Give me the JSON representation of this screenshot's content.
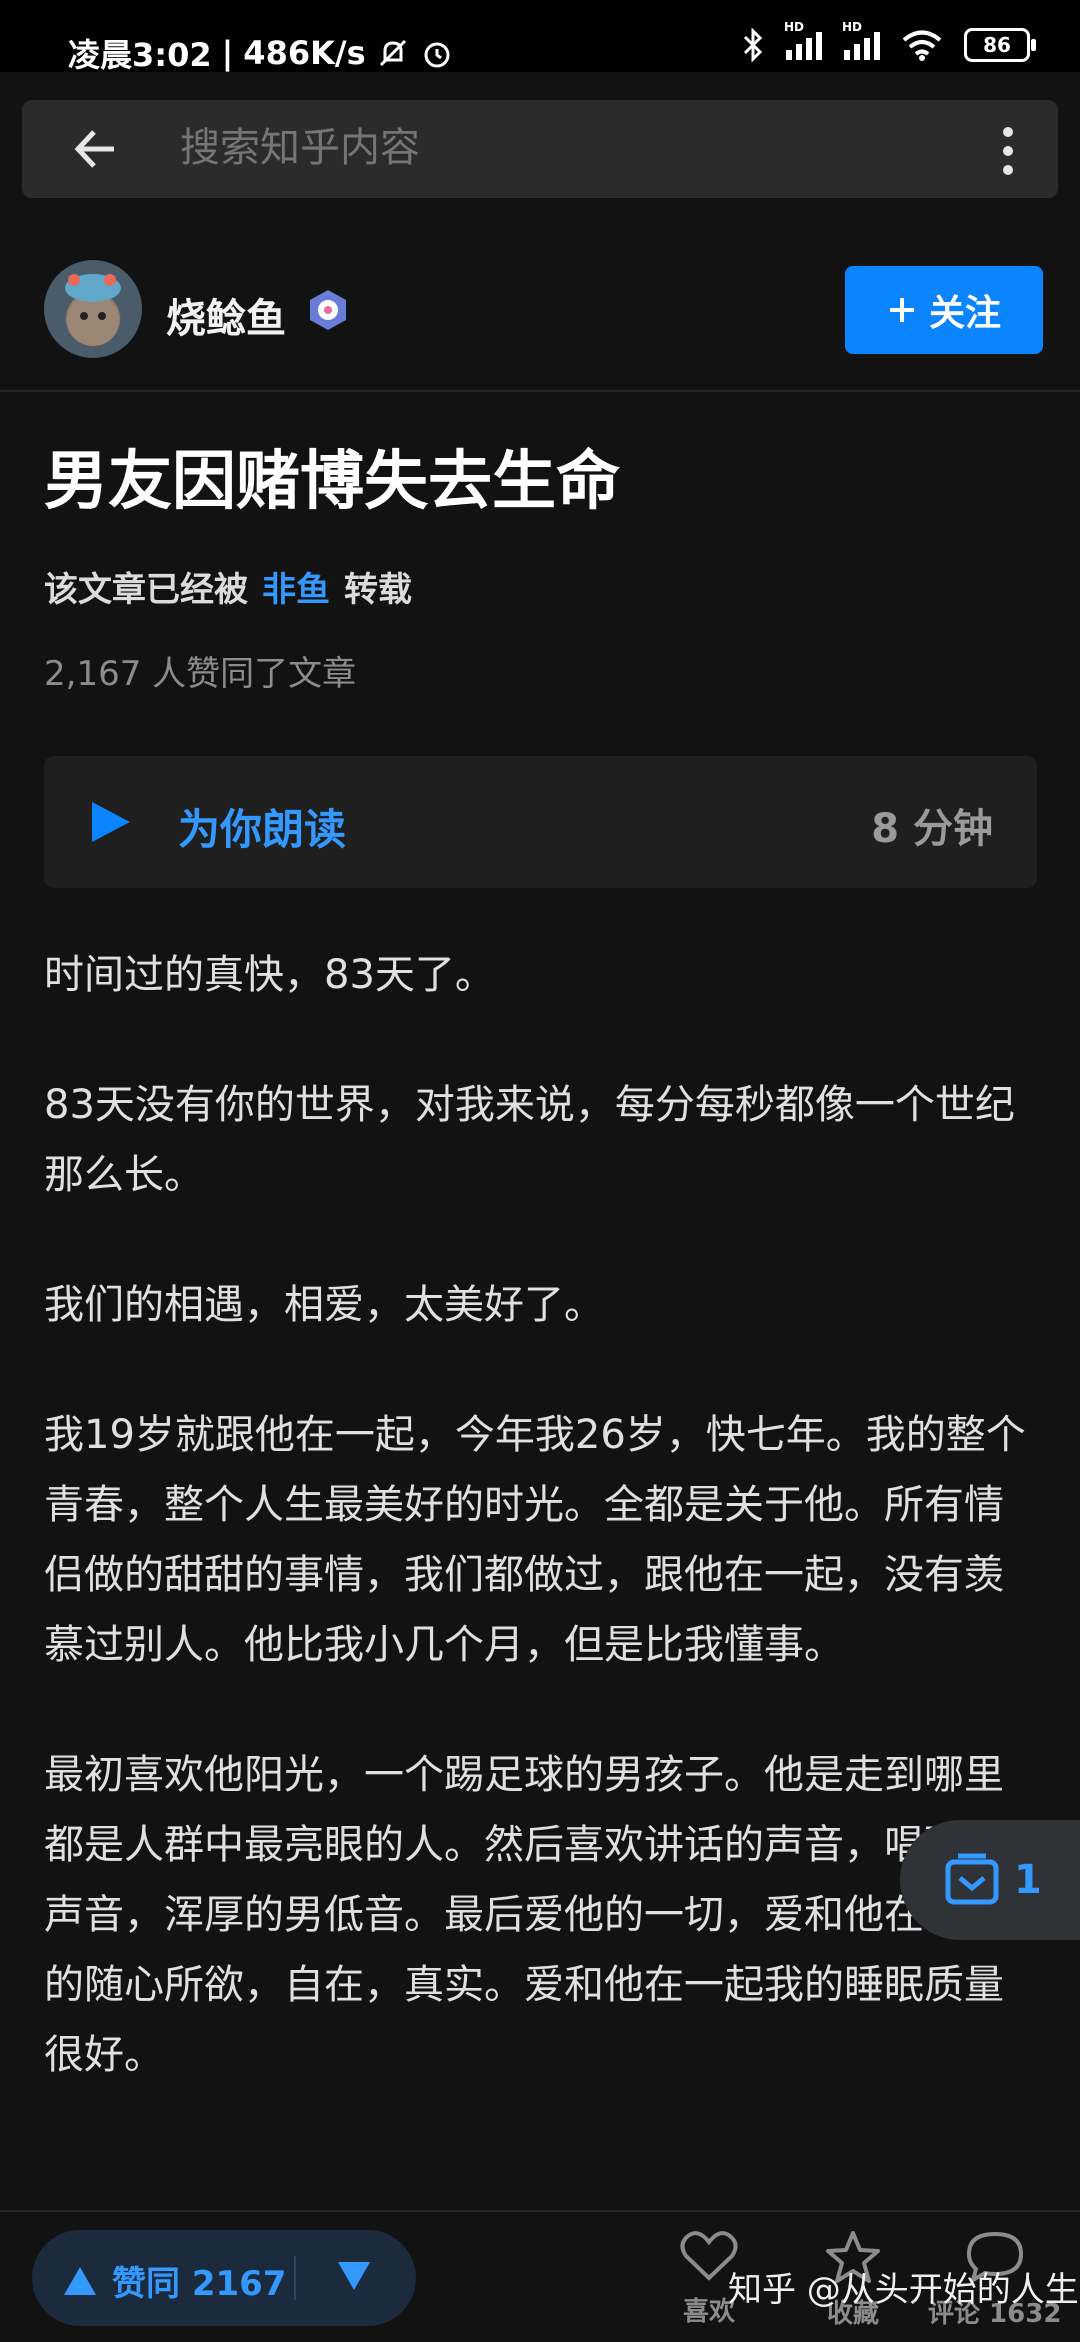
{
  "status": {
    "time": "凌晨3:02",
    "speed": "486K/s",
    "battery": "86",
    "sig_label": "HD"
  },
  "search": {
    "placeholder": "搜索知乎内容"
  },
  "author": {
    "name": "烧鲶鱼",
    "follow_label": "关注"
  },
  "article": {
    "title": "男友因赌博失去生命",
    "repost_prefix": "该文章已经被",
    "repost_user": "非鱼",
    "repost_suffix": "转载",
    "likes_line": "2,167 人赞同了文章",
    "read_label": "为你朗读",
    "read_time": "8 分钟",
    "paragraphs": [
      "时间过的真快，83天了。",
      "83天没有你的世界，对我来说，每分每秒都像一个世纪那么长。",
      "我们的相遇，相爱，太美好了。",
      "我19岁就跟他在一起，今年我26岁，快七年。我的整个青春，整个人生最美好的时光。全都是关于他。所有情侣做的甜甜的事情，我们都做过，跟他在一起，没有羡慕过别人。他比我小几个月，但是比我懂事。",
      "最初喜欢他阳光，一个踢足球的男孩子。他是走到哪里都是人群中最亮眼的人。然后喜欢讲话的声音，唱歌的声音，浑厚的男低音。最后爱他的一切，爱和他在一起的随心所欲，自在，真实。爱和他在一起我的睡眠质量很好。"
    ]
  },
  "float": {
    "count": "1"
  },
  "bottom": {
    "upvote_label": "赞同 2167",
    "like_label": "喜欢",
    "fav_label": "收藏",
    "comment_label": "评论 1632",
    "watermark": "知乎 @从头开始的人生"
  },
  "colors": {
    "accent": "#0a84ff",
    "link": "#3399ff",
    "background": "#121212"
  }
}
